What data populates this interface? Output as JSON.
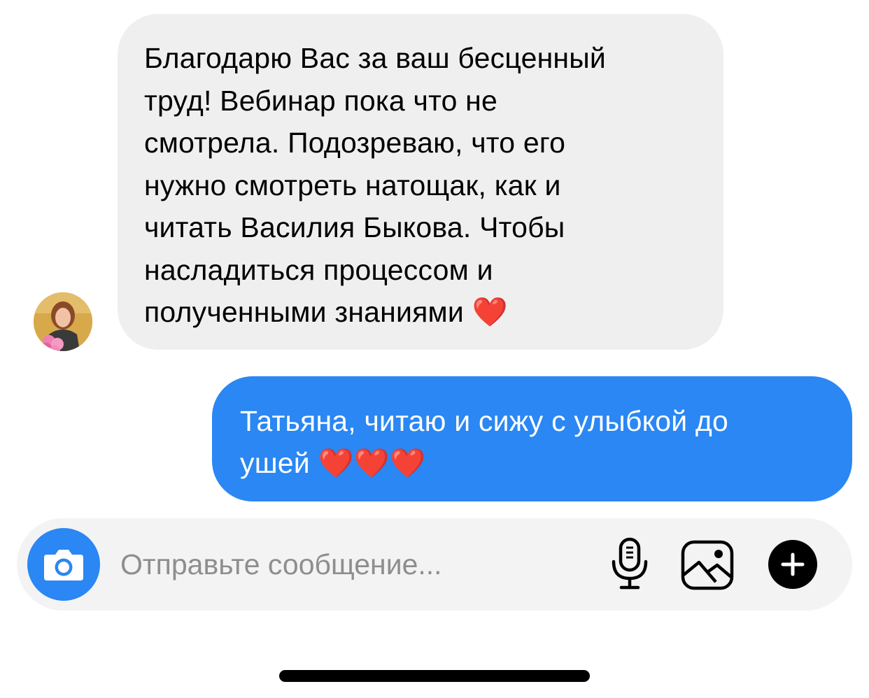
{
  "thread": {
    "incoming": {
      "text": "Благодарю Вас за ваш бесценный\nтруд! Вебинар пока что не\nсмотрела. Подозреваю, что его\nнужно смотреть натощак, как и\nчитать Василия Быкова. Чтобы\nнасладиться процессом и\nполученными знаниями ❤️"
    },
    "outgoing": {
      "text": "Татьяна, читаю и сижу с улыбкой до\nушей ❤️❤️❤️"
    }
  },
  "composer": {
    "placeholder": "Отправьте сообщение...",
    "value": ""
  },
  "icons": {
    "camera": "camera-icon",
    "mic": "microphone-icon",
    "gallery": "image-icon",
    "plus": "plus-icon"
  },
  "colors": {
    "incoming_bubble": "#efefef",
    "outgoing_bubble": "#2a87f3",
    "accent": "#2a87f3",
    "composer_bg": "#f3f3f3"
  }
}
